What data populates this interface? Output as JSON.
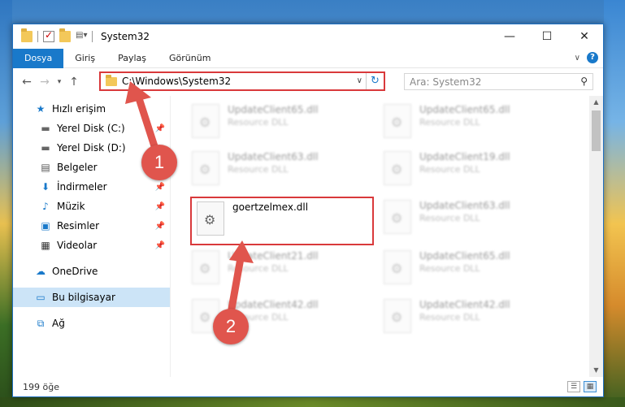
{
  "window": {
    "title": "System32",
    "controls": {
      "minimize": "—",
      "maximize": "☐",
      "close": "✕"
    }
  },
  "ribbon": {
    "tabs": [
      "Dosya",
      "Giriş",
      "Paylaş",
      "Görünüm"
    ]
  },
  "navbar": {
    "address": "C:\\Windows\\System32",
    "search_placeholder": "Ara: System32"
  },
  "sidebar": {
    "items": [
      {
        "label": "Hızlı erişim",
        "icon": "star-icon"
      },
      {
        "label": "Yerel Disk (C:)",
        "icon": "drive-icon",
        "pinned": true
      },
      {
        "label": "Yerel Disk (D:)",
        "icon": "drive-icon"
      },
      {
        "label": "Belgeler",
        "icon": "document-icon"
      },
      {
        "label": "İndirmeler",
        "icon": "download-icon",
        "pinned": true
      },
      {
        "label": "Müzik",
        "icon": "music-icon",
        "pinned": true
      },
      {
        "label": "Resimler",
        "icon": "pictures-icon",
        "pinned": true
      },
      {
        "label": "Videolar",
        "icon": "video-icon",
        "pinned": true
      },
      {
        "label": "OneDrive",
        "icon": "cloud-icon"
      },
      {
        "label": "Bu bilgisayar",
        "icon": "computer-icon",
        "selected": true
      },
      {
        "label": "Ağ",
        "icon": "network-icon"
      }
    ]
  },
  "files": [
    {
      "name": "UpdateClient65.dll",
      "type": "Resource DLL"
    },
    {
      "name": "UpdateClient65.dll",
      "type": "Resource DLL"
    },
    {
      "name": "UpdateClient63.dll",
      "type": "Resource DLL"
    },
    {
      "name": "UpdateClient19.dll",
      "type": "Resource DLL"
    },
    {
      "name": "goertzelmex.dll",
      "type": ""
    },
    {
      "name": "UpdateClient63.dll",
      "type": "Resource DLL"
    },
    {
      "name": "UpdateClient21.dll",
      "type": "Resource DLL"
    },
    {
      "name": "UpdateClient65.dll",
      "type": "Resource DLL"
    },
    {
      "name": "UpdateClient42.dll",
      "type": "Resource DLL"
    },
    {
      "name": "UpdateClient42.dll",
      "type": "Resource DLL"
    }
  ],
  "status": {
    "count": "199 öğe"
  },
  "callouts": [
    "1",
    "2"
  ],
  "colors": {
    "accent": "#1979ca",
    "highlight": "#d9393b",
    "callout": "#e0554d"
  }
}
